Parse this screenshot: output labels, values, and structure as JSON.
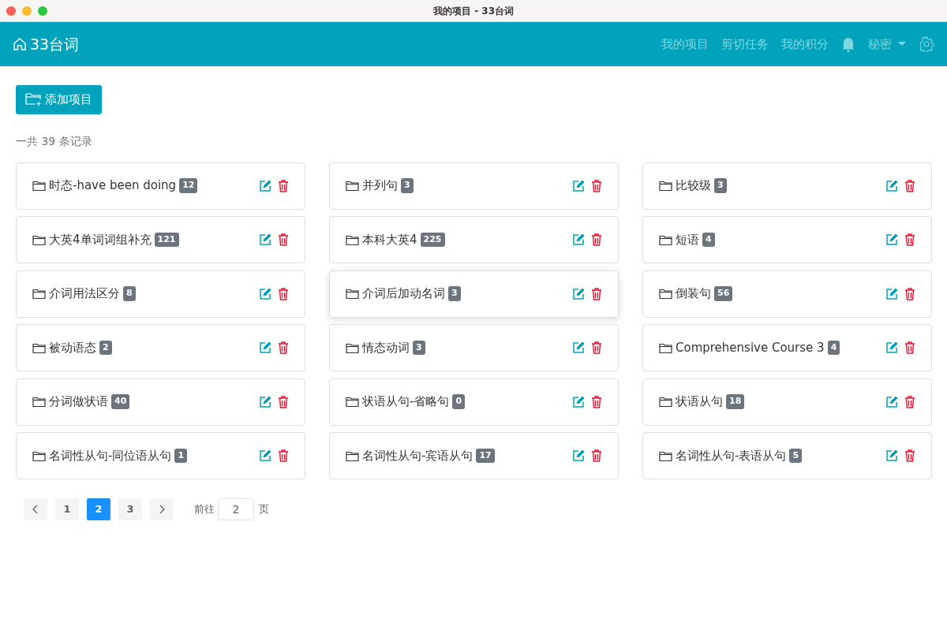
{
  "window": {
    "title": "我的项目 - 33台词"
  },
  "navbar": {
    "brand": "33台词",
    "links": [
      "我的项目",
      "剪切任务",
      "我的积分"
    ],
    "user": "秘密"
  },
  "add_button": "添加项目",
  "record_count": "一共 39 条记录",
  "projects": [
    {
      "name": "时态-have been doing",
      "count": "12",
      "hovered": false
    },
    {
      "name": "并列句",
      "count": "3",
      "hovered": false
    },
    {
      "name": "比较级",
      "count": "3",
      "hovered": false
    },
    {
      "name": "大英4单词词组补充",
      "count": "121",
      "hovered": false
    },
    {
      "name": "本科大英4",
      "count": "225",
      "hovered": false
    },
    {
      "name": "短语",
      "count": "4",
      "hovered": false
    },
    {
      "name": "介词用法区分",
      "count": "8",
      "hovered": false
    },
    {
      "name": "介词后加动名词",
      "count": "3",
      "hovered": true
    },
    {
      "name": "倒装句",
      "count": "56",
      "hovered": false
    },
    {
      "name": "被动语态",
      "count": "2",
      "hovered": false
    },
    {
      "name": "情态动词",
      "count": "3",
      "hovered": false
    },
    {
      "name": "Comprehensive Course 3",
      "count": "4",
      "hovered": false
    },
    {
      "name": "分词做状语",
      "count": "40",
      "hovered": false
    },
    {
      "name": "状语从句-省略句",
      "count": "0",
      "hovered": false
    },
    {
      "name": "状语从句",
      "count": "18",
      "hovered": false
    },
    {
      "name": "名词性从句-同位语从句",
      "count": "1",
      "hovered": false
    },
    {
      "name": "名词性从句-宾语从句",
      "count": "17",
      "hovered": false
    },
    {
      "name": "名词性从句-表语从句",
      "count": "5",
      "hovered": false
    }
  ],
  "pagination": {
    "pages": [
      {
        "label": "1",
        "selected": false
      },
      {
        "label": "2",
        "selected": true
      },
      {
        "label": "3",
        "selected": false
      }
    ],
    "goto_label": "前往",
    "goto_value": "2",
    "page_suffix": "页"
  }
}
